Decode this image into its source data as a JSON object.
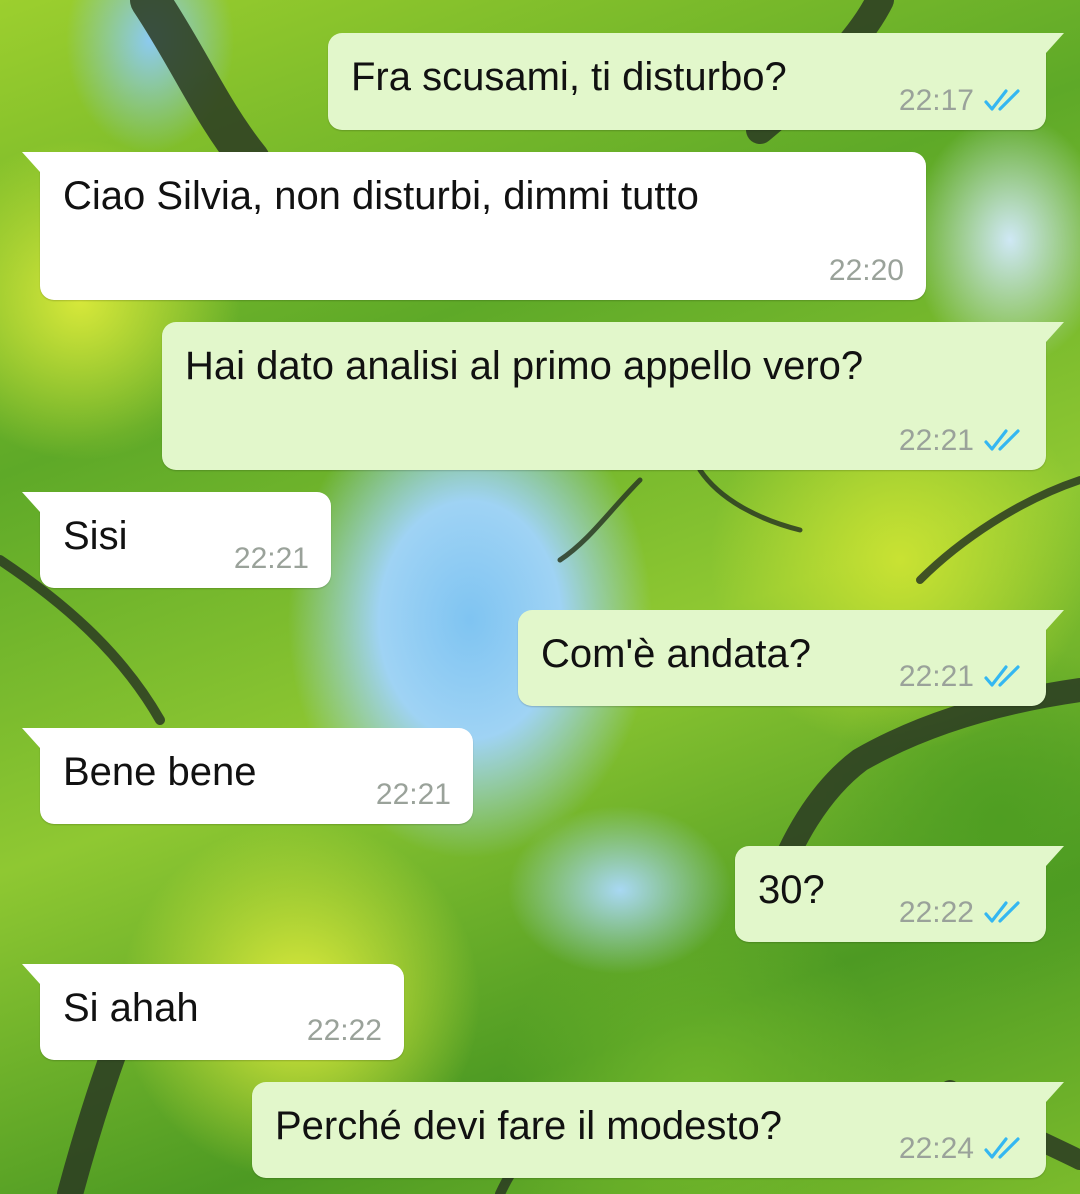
{
  "chat": {
    "messages": [
      {
        "dir": "out",
        "text": "Fra scusami, ti disturbo?",
        "time": "22:17",
        "status_icon": "double-check-read-icon"
      },
      {
        "dir": "in",
        "text": "Ciao Silvia, non disturbi, dimmi tutto",
        "time": "22:20"
      },
      {
        "dir": "out",
        "text": "Hai dato analisi al primo appello vero?",
        "time": "22:21",
        "status_icon": "double-check-read-icon"
      },
      {
        "dir": "in",
        "text": "Sisi",
        "time": "22:21"
      },
      {
        "dir": "out",
        "text": "Com'è andata?",
        "time": "22:21",
        "status_icon": "double-check-read-icon"
      },
      {
        "dir": "in",
        "text": "Bene bene",
        "time": "22:21"
      },
      {
        "dir": "out",
        "text": "30?",
        "time": "22:22",
        "status_icon": "double-check-read-icon"
      },
      {
        "dir": "in",
        "text": "Si ahah",
        "time": "22:22"
      },
      {
        "dir": "out",
        "text": "Perché devi fare il modesto?",
        "time": "22:24",
        "status_icon": "double-check-read-icon"
      }
    ]
  },
  "colors": {
    "outgoing_bubble": "#e2f7cb",
    "incoming_bubble": "#ffffff",
    "read_tick": "#34b7f1",
    "timestamp": "#9aa29a"
  }
}
